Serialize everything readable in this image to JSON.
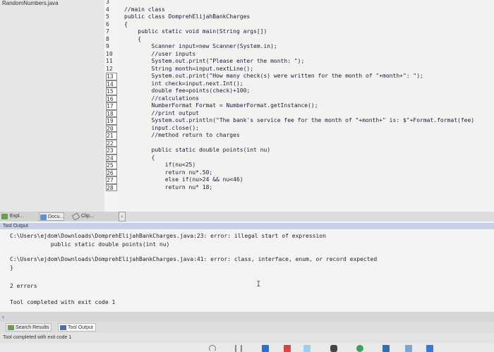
{
  "file_panel": {
    "title": "RandomNumbers.java",
    "tabs": [
      {
        "label": "Expl...",
        "icon": "explorer-icon"
      },
      {
        "label": "Docu...",
        "icon": "document-icon"
      },
      {
        "label": "Clip...",
        "icon": "clipboard-icon"
      }
    ]
  },
  "editor": {
    "line_numbers": [
      "3",
      "4",
      "5",
      "6",
      "7",
      "8",
      "9",
      "10",
      "11",
      "12",
      "13",
      "14",
      "15",
      "16",
      "17",
      "18",
      "19",
      "20",
      "21",
      "22",
      "23",
      "24",
      "25",
      "26",
      "27",
      "28"
    ],
    "lines": [
      "",
      "//main class",
      "public class DomprehElijahBankCharges",
      "{",
      "    public static void main(String args[])",
      "    {",
      "        Scanner input=new Scanner(System.in);",
      "        //user inputs",
      "        System.out.print(\"Please enter the month: \");",
      "        String month=input.nextLine();",
      "        System.out.print(\"How many check(s) were written for the month of \"+month+\": \");",
      "        int check=input.next.Int();",
      "        double fee=points(check)+100;",
      "        //calculations",
      "        NumberFormat Format = NumberFormat.getInstance();",
      "        //print output",
      "        System.out.println(\"The bank's service fee for the month of \"+month+\" is: $\"+Format.format(fee)",
      "        input.close();",
      "        //method return to charges",
      "",
      "        public static double points(int nu)",
      "        {",
      "            if(nu<25)",
      "            return nu*.50;",
      "            else if(nu>24 && nu<46)",
      "            return nu* 18;"
    ]
  },
  "tool_output": {
    "header": "Tool Output",
    "lines": [
      "C:\\Users\\ejdom\\Downloads\\DomprehElijahBankCharges.java:23: error: illegal start of expression",
      "            public static double points(int nu)",
      "",
      "C:\\Users\\ejdom\\Downloads\\DomprehElijahBankCharges.java:41: error: class, interface, enum, or record expected",
      "}",
      "",
      "2 errors",
      "",
      "Tool completed with exit code 1"
    ]
  },
  "bottom_tabs": [
    {
      "label": "Search Results",
      "icon": "search-results-icon"
    },
    {
      "label": "Tool Output",
      "icon": "tool-output-icon"
    }
  ],
  "status_bar": {
    "text": "Tool completed with exit code 1"
  },
  "colors": {
    "editor_bg": "#f2f2f0",
    "output_header": "#c9cfe6",
    "code_text": "#1a1a3a"
  }
}
